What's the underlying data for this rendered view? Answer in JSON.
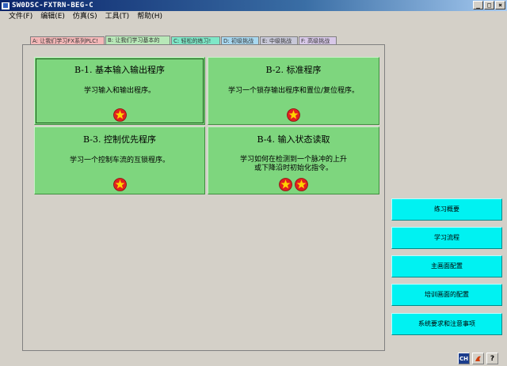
{
  "window": {
    "title": "SW0DSC-FXTRN-BEG-C",
    "controls": [
      "_",
      "□",
      "×"
    ]
  },
  "menu": [
    {
      "label": "文件(F)"
    },
    {
      "label": "编辑(E)"
    },
    {
      "label": "仿真(S)"
    },
    {
      "label": "工具(T)"
    },
    {
      "label": "帮助(H)"
    }
  ],
  "tabs": [
    {
      "label": "A: 让我们学习FX系列PLC!",
      "color": "#f4b8b8"
    },
    {
      "label": "B: 让我们学习基本的",
      "color": "#b8e8b8"
    },
    {
      "label": "C: 轻松的练习!",
      "color": "#7ee8c8"
    },
    {
      "label": "D: 初级挑战",
      "color": "#a8d8f0"
    },
    {
      "label": "E: 中级挑战",
      "color": "#c8c8d8"
    },
    {
      "label": "F: 高级挑战",
      "color": "#d8c8e8"
    }
  ],
  "cards": [
    {
      "title": "B-1. 基本输入输出程序",
      "desc": "学习输入和输出程序。",
      "stars": 1
    },
    {
      "title": "B-2. 标准程序",
      "desc": "学习一个锁存输出程序和置位/复位程序。",
      "stars": 1
    },
    {
      "title": "B-3. 控制优先程序",
      "desc": "学习一个控制车流的互锁程序。",
      "stars": 1
    },
    {
      "title": "B-4. 输入状态读取",
      "desc": "学习如何在检测到一个脉冲的上升或下降沿时初始化指令。",
      "stars": 2
    }
  ],
  "sidebar": {
    "buttons": [
      {
        "label": "练习概要"
      },
      {
        "label": "学习流程"
      },
      {
        "label": "主画面配置"
      },
      {
        "label": "培训画面的配置"
      },
      {
        "label": "系统要求和注意事项"
      }
    ]
  },
  "tray": {
    "ch_label": "CH",
    "help_label": "?"
  },
  "colors": {
    "card": "#7ed67e",
    "side_button": "#00f2f2",
    "star": "#ffd200",
    "star_circle": "#e02020"
  }
}
